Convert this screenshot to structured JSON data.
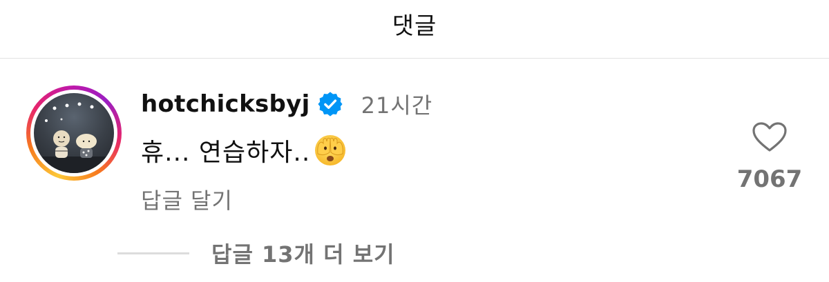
{
  "header": {
    "title": "댓글"
  },
  "comment": {
    "avatar_icon": "profile-avatar",
    "username": "hotchicksbyj",
    "verified_icon": "verified-badge-icon",
    "time": "21시간",
    "text": "휴... 연습하자..",
    "emoji_icon": "face-with-peeking-eye-emoji",
    "reply_label": "답글 달기",
    "like_icon": "heart-outline-icon",
    "like_count": "7067"
  },
  "replies": {
    "view_more_label": "답글 13개 더 보기"
  },
  "colors": {
    "secondary_text": "#737373",
    "verified_blue": "#0095f6",
    "divider": "#e2e2e2"
  }
}
